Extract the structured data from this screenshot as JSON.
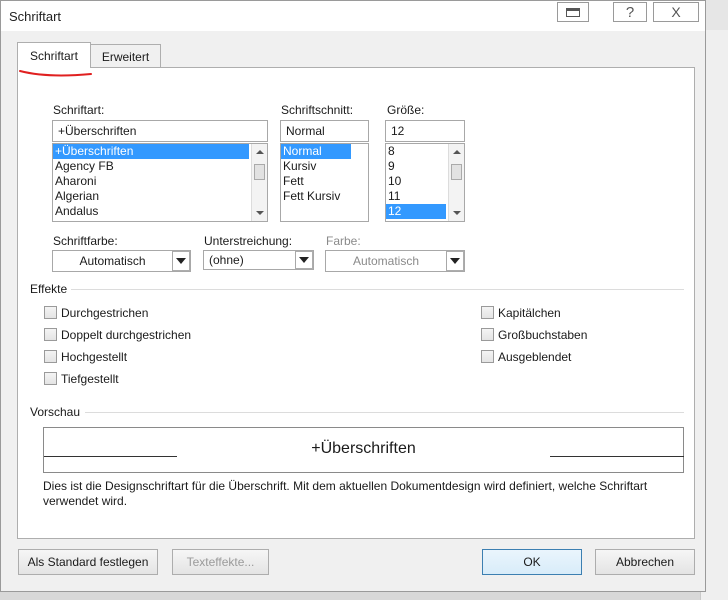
{
  "window": {
    "title": "Schriftart"
  },
  "titlebar": {
    "help_label": "?",
    "close_label": "X"
  },
  "tabs": [
    {
      "label": "Schriftart"
    },
    {
      "label": "Erweitert"
    }
  ],
  "font": {
    "label": "Schriftart:",
    "value": "+Überschriften",
    "items": [
      "+Überschriften",
      "Agency FB",
      "Aharoni",
      "Algerian",
      "Andalus"
    ]
  },
  "style": {
    "label": "Schriftschnitt:",
    "value": "Normal",
    "items": [
      "Normal",
      "Kursiv",
      "Fett",
      "Fett Kursiv"
    ]
  },
  "size": {
    "label": "Größe:",
    "value": "12",
    "items": [
      "8",
      "9",
      "10",
      "11",
      "12"
    ]
  },
  "font_color": {
    "label": "Schriftfarbe:",
    "value": "Automatisch"
  },
  "underline": {
    "label": "Unterstreichung:",
    "value": "(ohne)"
  },
  "underline_color": {
    "label": "Farbe:",
    "value": "Automatisch"
  },
  "effects": {
    "title": "Effekte",
    "left": [
      "Durchgestrichen",
      "Doppelt durchgestrichen",
      "Hochgestellt",
      "Tiefgestellt"
    ],
    "right": [
      "Kapitälchen",
      "Großbuchstaben",
      "Ausgeblendet"
    ]
  },
  "preview": {
    "title": "Vorschau",
    "sample_text": "+Überschriften",
    "description": "Dies ist die Designschriftart für die Überschrift. Mit dem aktuellen Dokumentdesign wird definiert, welche Schriftart verwendet wird."
  },
  "buttons": {
    "set_default": "Als Standard festlegen",
    "text_effects": "Texteffekte...",
    "ok": "OK",
    "cancel": "Abbrechen"
  },
  "colors": {
    "selection": "#3399ff",
    "ok_border": "#3c7fb1",
    "annotation": "#e02020"
  }
}
